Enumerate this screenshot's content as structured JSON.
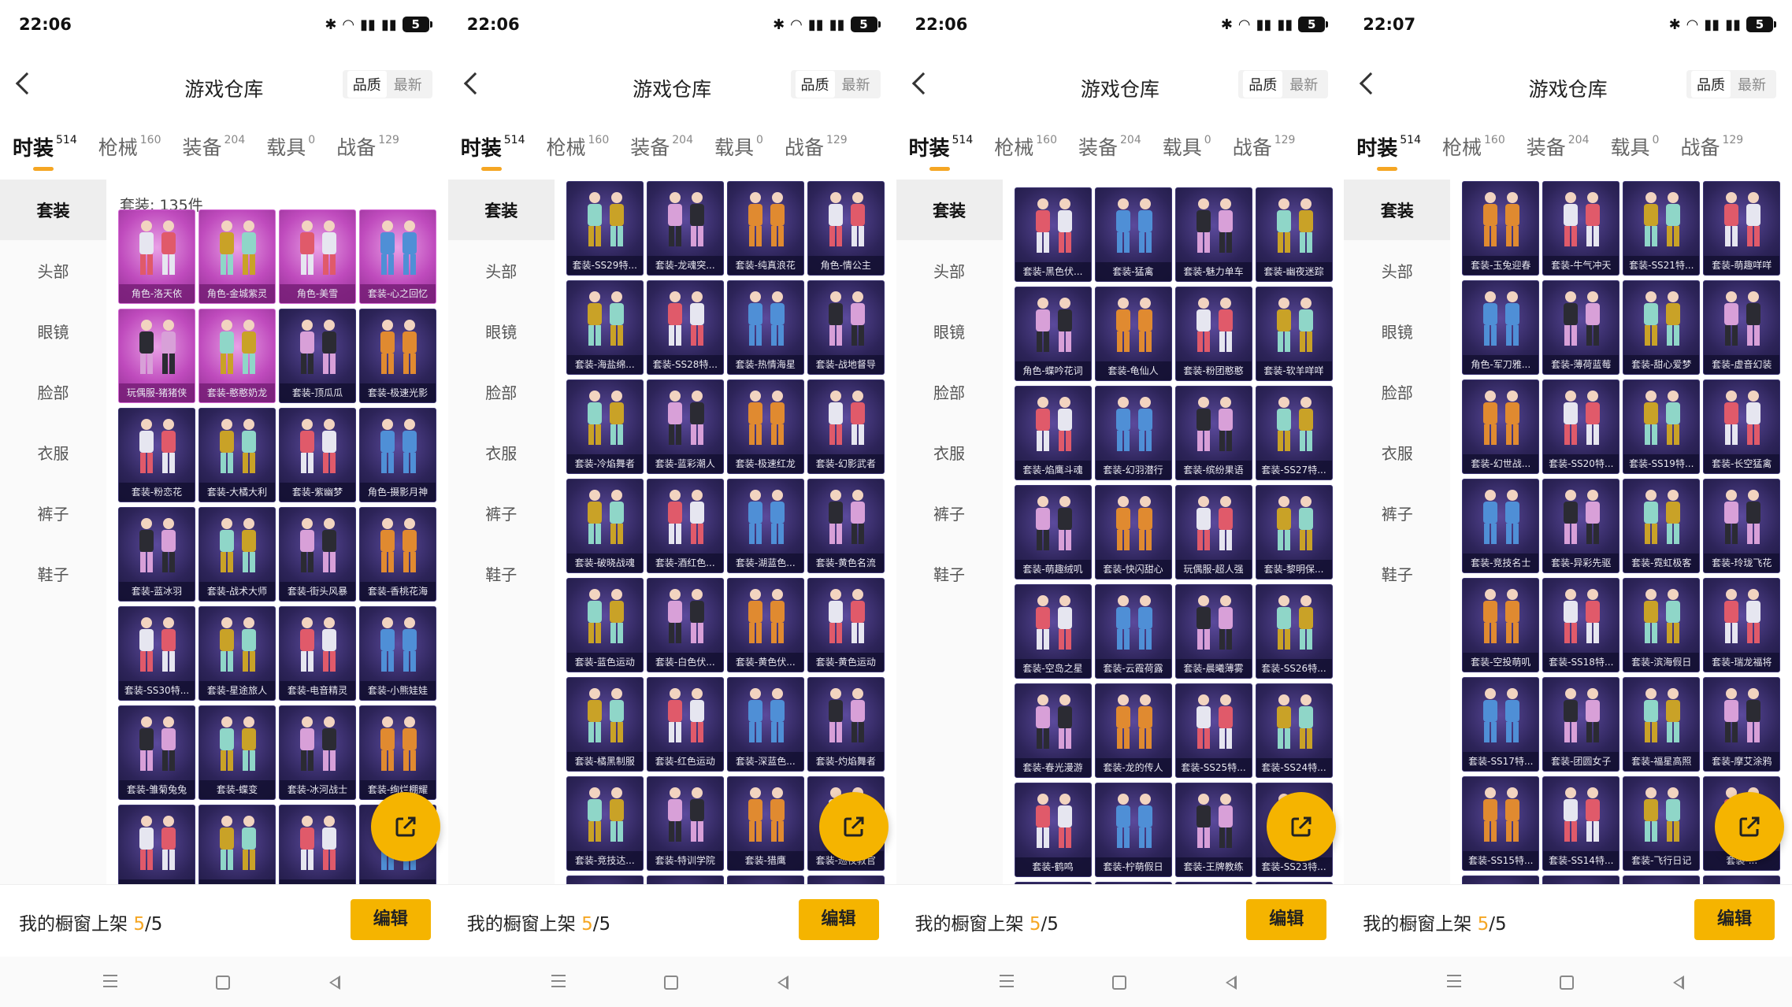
{
  "common": {
    "title": "游戏仓库",
    "sort_quality": "品质",
    "sort_latest": "最新",
    "tabs": [
      {
        "label": "时装",
        "count": "514"
      },
      {
        "label": "枪械",
        "count": "160"
      },
      {
        "label": "装备",
        "count": "204"
      },
      {
        "label": "载具",
        "count": "0"
      },
      {
        "label": "战备",
        "count": "129"
      }
    ],
    "sidebar": [
      "套装",
      "头部",
      "眼镜",
      "脸部",
      "衣服",
      "裤子",
      "鞋子"
    ],
    "bottom_text": "我的橱窗上架 ",
    "bottom_num": "5",
    "bottom_total": "/5",
    "edit_label": "编辑",
    "colors": {
      "accent": "#f5b400",
      "legend": "#bf4bbd",
      "epic": "#2d2459"
    }
  },
  "phones": [
    {
      "time": "22:06",
      "count_label": "套装: 135件",
      "items": [
        {
          "label": "角色-洛天依",
          "tier": "legend"
        },
        {
          "label": "角色-金城紫灵",
          "tier": "legend"
        },
        {
          "label": "角色-美雪",
          "tier": "legend"
        },
        {
          "label": "套装-心之回忆",
          "tier": "legend"
        },
        {
          "label": "玩偶服-猪猪侠",
          "tier": "legend"
        },
        {
          "label": "套装-憨憨奶龙",
          "tier": "legend"
        },
        {
          "label": "套装-顶瓜瓜",
          "tier": "epic"
        },
        {
          "label": "套装-极速光影",
          "tier": "epic"
        },
        {
          "label": "套装-粉恋花",
          "tier": "epic"
        },
        {
          "label": "套装-大橘大利",
          "tier": "epic"
        },
        {
          "label": "套装-紫幽梦",
          "tier": "epic"
        },
        {
          "label": "角色-摄影月神",
          "tier": "epic"
        },
        {
          "label": "套装-蓝冰羽",
          "tier": "epic"
        },
        {
          "label": "套装-战术大师",
          "tier": "epic"
        },
        {
          "label": "套装-街头风暴",
          "tier": "epic"
        },
        {
          "label": "套装-香桃花海",
          "tier": "epic"
        },
        {
          "label": "套装-SS30特...",
          "tier": "epic"
        },
        {
          "label": "套装-星途旅人",
          "tier": "epic"
        },
        {
          "label": "套装-电音精灵",
          "tier": "epic"
        },
        {
          "label": "套装-小熊娃娃",
          "tier": "epic"
        },
        {
          "label": "套装-雏菊兔兔",
          "tier": "epic"
        },
        {
          "label": "套装-蝶变",
          "tier": "epic"
        },
        {
          "label": "套装-冰河战士",
          "tier": "epic"
        },
        {
          "label": "套装-绚烂棚耀",
          "tier": "epic"
        },
        {
          "label": "",
          "tier": "epic"
        },
        {
          "label": "",
          "tier": "epic"
        },
        {
          "label": "",
          "tier": "epic"
        },
        {
          "label": "",
          "tier": "epic"
        }
      ]
    },
    {
      "time": "22:06",
      "count_label": "",
      "items": [
        {
          "label": "套装-SS29特...",
          "tier": "epic"
        },
        {
          "label": "套装-龙魂突...",
          "tier": "epic"
        },
        {
          "label": "套装-纯真浪花",
          "tier": "epic"
        },
        {
          "label": "角色-情公主",
          "tier": "epic"
        },
        {
          "label": "套装-海盐绵...",
          "tier": "epic"
        },
        {
          "label": "套装-SS28特...",
          "tier": "epic"
        },
        {
          "label": "套装-热情海星",
          "tier": "epic"
        },
        {
          "label": "套装-战地督导",
          "tier": "epic"
        },
        {
          "label": "套装-冷焰舞者",
          "tier": "epic"
        },
        {
          "label": "套装-蓝彩潮人",
          "tier": "epic"
        },
        {
          "label": "套装-极速红龙",
          "tier": "epic"
        },
        {
          "label": "套装-幻影武者",
          "tier": "epic"
        },
        {
          "label": "套装-破晓战魂",
          "tier": "epic"
        },
        {
          "label": "套装-酒红色...",
          "tier": "epic"
        },
        {
          "label": "套装-湖蓝色...",
          "tier": "epic"
        },
        {
          "label": "套装-黄色名流",
          "tier": "epic"
        },
        {
          "label": "套装-蓝色运动",
          "tier": "epic"
        },
        {
          "label": "套装-白色伏...",
          "tier": "epic"
        },
        {
          "label": "套装-黄色伏...",
          "tier": "epic"
        },
        {
          "label": "套装-黄色运动",
          "tier": "epic"
        },
        {
          "label": "套装-橘黑制服",
          "tier": "epic"
        },
        {
          "label": "套装-红色运动",
          "tier": "epic"
        },
        {
          "label": "套装-深蓝色...",
          "tier": "epic"
        },
        {
          "label": "套装-灼焰舞者",
          "tier": "epic"
        },
        {
          "label": "套装-竞技达...",
          "tier": "epic"
        },
        {
          "label": "套装-特训学院",
          "tier": "epic"
        },
        {
          "label": "套装-猎鹰",
          "tier": "epic"
        },
        {
          "label": "套装-巡夜教官",
          "tier": "epic"
        },
        {
          "label": "",
          "tier": "epic"
        },
        {
          "label": "",
          "tier": "epic"
        },
        {
          "label": "",
          "tier": "epic"
        },
        {
          "label": "",
          "tier": "epic"
        }
      ]
    },
    {
      "time": "22:06",
      "count_label": "",
      "items": [
        {
          "label": "套装-黑色伏...",
          "tier": "epic"
        },
        {
          "label": "套装-猛禽",
          "tier": "epic"
        },
        {
          "label": "套装-魅力单车",
          "tier": "epic"
        },
        {
          "label": "套装-幽夜迷踪",
          "tier": "epic"
        },
        {
          "label": "角色-蝶吟花词",
          "tier": "epic"
        },
        {
          "label": "套装-龟仙人",
          "tier": "epic"
        },
        {
          "label": "套装-粉团憨憨",
          "tier": "epic"
        },
        {
          "label": "套装-软羊咩咩",
          "tier": "epic"
        },
        {
          "label": "套装-焰鹰斗魂",
          "tier": "epic"
        },
        {
          "label": "套装-幻羽潜行",
          "tier": "epic"
        },
        {
          "label": "套装-缤纷果语",
          "tier": "epic"
        },
        {
          "label": "套装-SS27特...",
          "tier": "epic"
        },
        {
          "label": "套装-萌趣绒叽",
          "tier": "epic"
        },
        {
          "label": "套装-快闪甜心",
          "tier": "epic"
        },
        {
          "label": "玩偶服-超人强",
          "tier": "epic"
        },
        {
          "label": "套装-黎明保...",
          "tier": "epic"
        },
        {
          "label": "套装-空岛之星",
          "tier": "epic"
        },
        {
          "label": "套装-云霞荷露",
          "tier": "epic"
        },
        {
          "label": "套装-晨曦薄雾",
          "tier": "epic"
        },
        {
          "label": "套装-SS26特...",
          "tier": "epic"
        },
        {
          "label": "套装-春光漫游",
          "tier": "epic"
        },
        {
          "label": "套装-龙的传人",
          "tier": "epic"
        },
        {
          "label": "套装-SS25特...",
          "tier": "epic"
        },
        {
          "label": "套装-SS24特...",
          "tier": "epic"
        },
        {
          "label": "套装-鹤鸣",
          "tier": "epic"
        },
        {
          "label": "套装-柠萌假日",
          "tier": "epic"
        },
        {
          "label": "套装-王牌教练",
          "tier": "epic"
        },
        {
          "label": "套装-SS23特...",
          "tier": "epic"
        },
        {
          "label": "",
          "tier": "epic"
        },
        {
          "label": "",
          "tier": "epic"
        },
        {
          "label": "",
          "tier": "epic"
        },
        {
          "label": "",
          "tier": "epic"
        }
      ]
    },
    {
      "time": "22:07",
      "count_label": "",
      "items": [
        {
          "label": "套装-玉兔迎春",
          "tier": "epic"
        },
        {
          "label": "套装-牛气冲天",
          "tier": "epic"
        },
        {
          "label": "套装-SS21特...",
          "tier": "epic"
        },
        {
          "label": "套装-萌趣咩咩",
          "tier": "epic"
        },
        {
          "label": "角色-军刀雅...",
          "tier": "epic"
        },
        {
          "label": "套装-薄荷蓝莓",
          "tier": "epic"
        },
        {
          "label": "套装-甜心爱梦",
          "tier": "epic"
        },
        {
          "label": "套装-虚音幻装",
          "tier": "epic"
        },
        {
          "label": "套装-幻世战...",
          "tier": "epic"
        },
        {
          "label": "套装-SS20特...",
          "tier": "epic"
        },
        {
          "label": "套装-SS19特...",
          "tier": "epic"
        },
        {
          "label": "套装-长空猛禽",
          "tier": "epic"
        },
        {
          "label": "套装-竞技名士",
          "tier": "epic"
        },
        {
          "label": "套装-异彩先驱",
          "tier": "epic"
        },
        {
          "label": "套装-霓虹极客",
          "tier": "epic"
        },
        {
          "label": "套装-玲珑飞花",
          "tier": "epic"
        },
        {
          "label": "套装-空投萌叽",
          "tier": "epic"
        },
        {
          "label": "套装-SS18特...",
          "tier": "epic"
        },
        {
          "label": "套装-滨海假日",
          "tier": "epic"
        },
        {
          "label": "套装-瑞龙福将",
          "tier": "epic"
        },
        {
          "label": "套装-SS17特...",
          "tier": "epic"
        },
        {
          "label": "套装-团圆女子",
          "tier": "epic"
        },
        {
          "label": "套装-福星高照",
          "tier": "epic"
        },
        {
          "label": "套装-摩艾涂鸦",
          "tier": "epic"
        },
        {
          "label": "套装-SS15特...",
          "tier": "epic"
        },
        {
          "label": "套装-SS14特...",
          "tier": "epic"
        },
        {
          "label": "套装-飞行日记",
          "tier": "epic"
        },
        {
          "label": "套装-...",
          "tier": "epic"
        },
        {
          "label": "",
          "tier": "epic"
        },
        {
          "label": "",
          "tier": "epic"
        },
        {
          "label": "",
          "tier": "epic"
        },
        {
          "label": "",
          "tier": "epic"
        }
      ]
    }
  ]
}
